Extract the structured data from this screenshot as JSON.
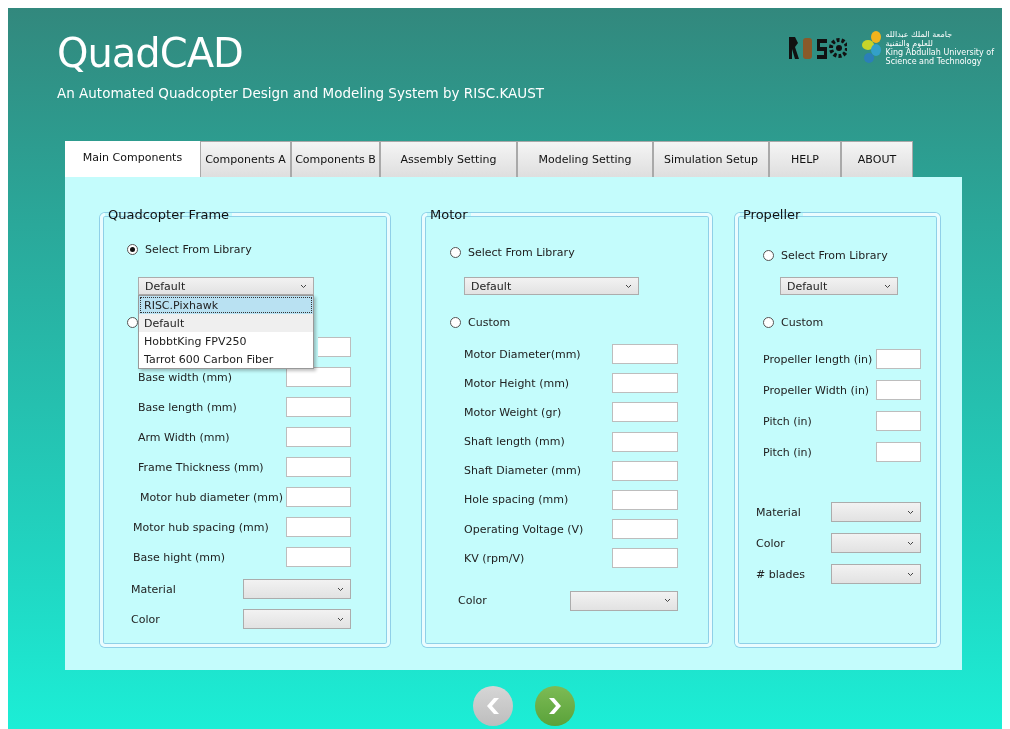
{
  "header": {
    "title": "QuadCAD",
    "subtitle": "An Automated Quadcopter Design and Modeling System by RISC.KAUST",
    "logo_text": [
      "جامعة الملك عبدالله",
      "للعلوم والتقنية",
      "King Abdullah University of",
      "Science and Technology"
    ]
  },
  "tabs": [
    {
      "label": "Main Components",
      "selected": true
    },
    {
      "label": "Components A",
      "selected": false
    },
    {
      "label": "Components B",
      "selected": false
    },
    {
      "label": "Assembly Setting",
      "selected": false
    },
    {
      "label": "Modeling Setting",
      "selected": false
    },
    {
      "label": "Simulation Setup",
      "selected": false
    },
    {
      "label": "HELP",
      "selected": false
    },
    {
      "label": "ABOUT",
      "selected": false
    }
  ],
  "groups": [
    {
      "title": "Quadcopter Frame",
      "options": [
        {
          "label": "Select From Library",
          "selected": true
        },
        {
          "selected": false
        }
      ],
      "dropdown": {
        "value": "Default",
        "expanded": true,
        "items": [
          {
            "label": "RISC.Pixhawk",
            "selected": false,
            "highlighted": true
          },
          {
            "label": "Default",
            "selected": true,
            "highlighted": false
          },
          {
            "label": "HobbtKing FPV250",
            "selected": false,
            "highlighted": false
          },
          {
            "label": "Tarrot 600 Carbon Fiber",
            "selected": false,
            "highlighted": false
          }
        ]
      },
      "fields": [
        {
          "kind": "covered"
        },
        {
          "label": "Base width (mm)"
        },
        {
          "label": "Base length (mm)"
        },
        {
          "label": "Arm Width (mm)"
        },
        {
          "label": "Frame Thickness (mm)"
        },
        {
          "label": "Motor hub diameter (mm)"
        },
        {
          "label": "Motor hub spacing (mm)"
        },
        {
          "label": "Base hight (mm)"
        }
      ],
      "selects": [
        {
          "label": "Material"
        },
        {
          "label": "Color"
        }
      ]
    },
    {
      "title": "Motor",
      "options": [
        {
          "label": "Select From Library",
          "selected": false
        },
        {
          "label": "Custom",
          "selected": false
        }
      ],
      "dropdown": {
        "value": "Default"
      },
      "fields": [
        {
          "label": "Motor Diameter(mm)"
        },
        {
          "label": "Motor Height (mm)"
        },
        {
          "label": "Motor Weight (gr)"
        },
        {
          "label": "Shaft length (mm)"
        },
        {
          "label": "Shaft Diameter (mm)"
        },
        {
          "label": "Hole spacing (mm)"
        },
        {
          "label": "Operating Voltage (V)"
        },
        {
          "label": "KV (rpm/V)"
        }
      ],
      "selects": [
        {
          "label": "Color"
        }
      ]
    },
    {
      "title": "Propeller",
      "options": [
        {
          "label": "Select From Library",
          "selected": false
        },
        {
          "label": "Custom",
          "selected": false
        }
      ],
      "dropdown": {
        "value": "Default"
      },
      "fields": [
        {
          "label": "Propeller length (in)"
        },
        {
          "label": "Propeller Width (in)"
        },
        {
          "label": "Pitch (in)"
        },
        {
          "label": "Pitch (in)"
        }
      ],
      "selects": [
        {
          "label": "Material"
        },
        {
          "label": "Color"
        },
        {
          "label": "# blades"
        }
      ]
    }
  ],
  "nav": [
    {
      "kind": "back",
      "disabled": true
    },
    {
      "kind": "forward",
      "disabled": false
    }
  ]
}
